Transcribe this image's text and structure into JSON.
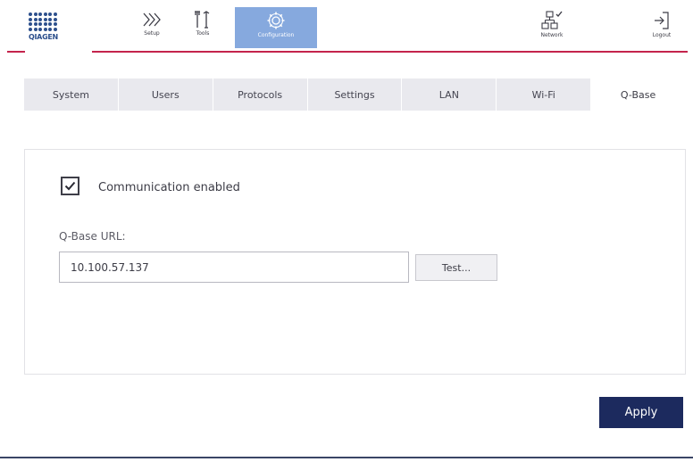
{
  "brand": {
    "logo_text": "QIAGEN",
    "accent_color": "#c4244c",
    "logo_color": "#2c4f8c"
  },
  "nav": {
    "setup": {
      "label": "Setup",
      "icon": "chevrons-right-icon"
    },
    "tools": {
      "label": "Tools",
      "icon": "tools-icon"
    },
    "configuration": {
      "label": "Configuration",
      "icon": "gear-icon",
      "active": true
    },
    "network": {
      "label": "Network",
      "icon": "network-icon"
    },
    "logout": {
      "label": "Logout",
      "icon": "logout-icon"
    }
  },
  "tabs": [
    {
      "label": "System"
    },
    {
      "label": "Users"
    },
    {
      "label": "Protocols"
    },
    {
      "label": "Settings"
    },
    {
      "label": "LAN"
    },
    {
      "label": "Wi-Fi"
    },
    {
      "label": "Q-Base",
      "active": true
    }
  ],
  "qbase": {
    "communication_label": "Communication enabled",
    "communication_enabled": true,
    "url_label": "Q-Base URL:",
    "url_value": "10.100.57.137",
    "test_label": "Test..."
  },
  "apply_label": "Apply",
  "colors": {
    "active_nav": "#86a9de",
    "apply_button": "#1c2a5e",
    "tab_inactive": "#e9e9ee"
  }
}
